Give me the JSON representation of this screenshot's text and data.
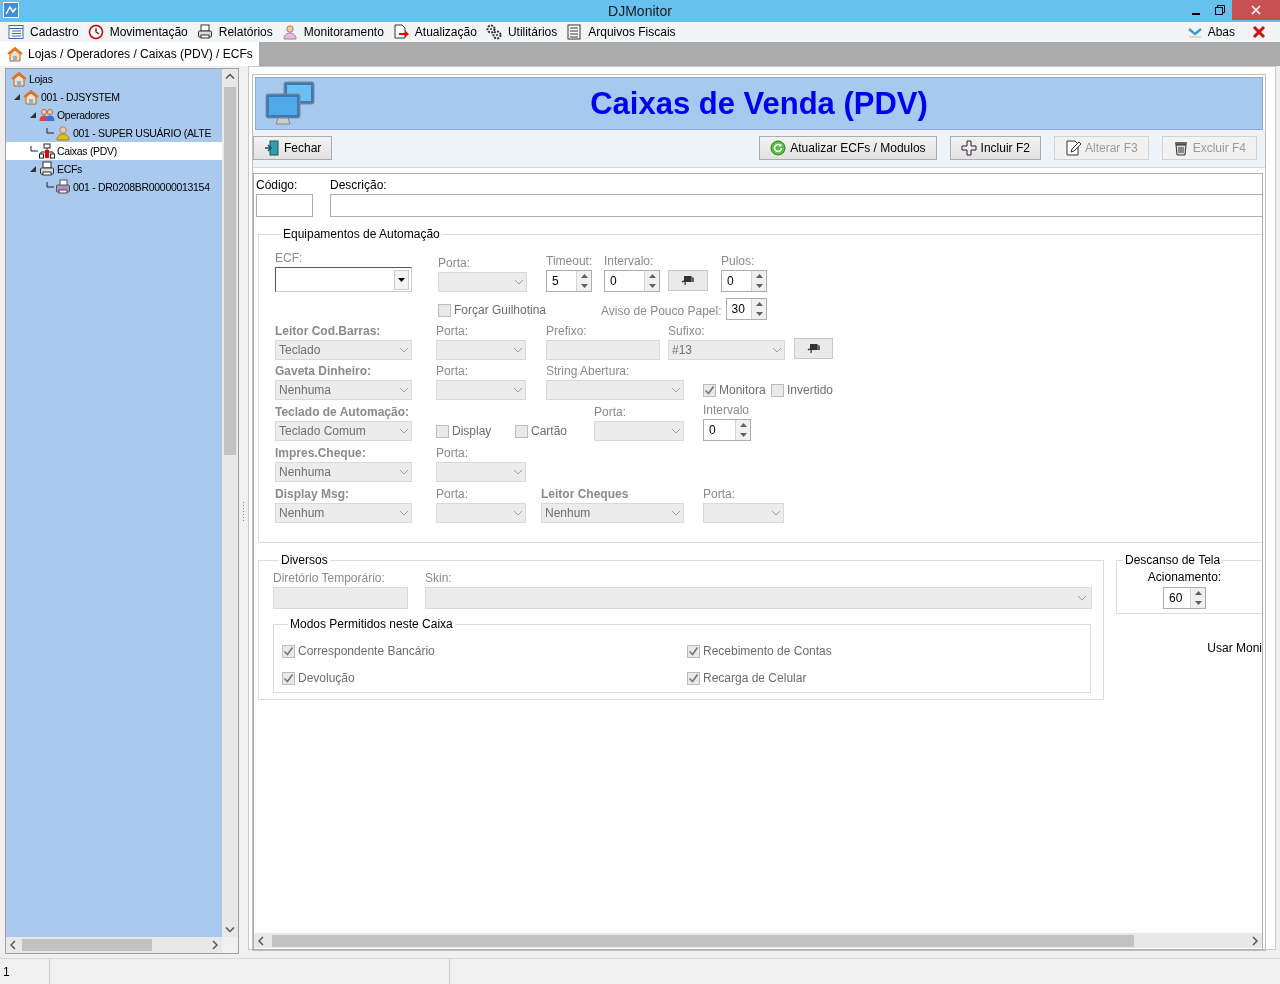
{
  "window": {
    "title": "DJMonitor"
  },
  "menu": [
    "Cadastro",
    "Movimentação",
    "Relatórios",
    "Monitoramento",
    "Atualização",
    "Utilitários",
    "Arquivos Fiscais"
  ],
  "menu_right": {
    "label": "Abas"
  },
  "tab": {
    "label": "Lojas / Operadores / Caixas (PDV) / ECFs"
  },
  "tree": [
    {
      "label": "Lojas",
      "kind": "store",
      "selected": false,
      "children": [
        {
          "label": "001 - DJSYSTEM",
          "kind": "store",
          "selected": false,
          "expanded": true,
          "children": [
            {
              "label": "Operadores",
              "kind": "group",
              "selected": false,
              "expanded": true,
              "children": [
                {
                  "label": "001 - SUPER USUÁRIO (ALTE",
                  "kind": "user",
                  "selected": false
                }
              ]
            },
            {
              "label": "Caixas (PDV)",
              "kind": "register",
              "selected": true
            },
            {
              "label": "ECFs",
              "kind": "printer",
              "selected": false,
              "expanded": true,
              "children": [
                {
                  "label": "001 - DR0208BR00000013154",
                  "kind": "ecf",
                  "selected": false
                }
              ]
            }
          ]
        }
      ]
    }
  ],
  "header": {
    "title": "Caixas de Venda (PDV)"
  },
  "toolbar": {
    "left_buttons": [
      {
        "label": "Fechar",
        "kind": "close",
        "disabled": false
      }
    ],
    "right_buttons": [
      {
        "label": "Atualizar ECFs / Modulos",
        "kind": "refresh",
        "disabled": false
      },
      {
        "label": "Incluir F2",
        "kind": "add",
        "disabled": false
      },
      {
        "label": "Alterar F3",
        "kind": "edit",
        "disabled": true
      },
      {
        "label": "Excluir F4",
        "kind": "delete",
        "disabled": true
      }
    ]
  },
  "record": {
    "code": {
      "label": "Código:"
    },
    "description": {
      "label": "Descrição:"
    }
  },
  "automation": {
    "title": "Equipamentos de Automação",
    "rows": [
      {
        "items": [
          {
            "kind": "combo",
            "label": "ECF:",
            "disabled": false
          },
          {
            "kind": "combo",
            "label": "Porta:",
            "disabled": true
          },
          {
            "kind": "spinner",
            "label": "Timeout:",
            "value": "5",
            "disabled": false
          },
          {
            "kind": "spinner",
            "label": "Intervalo:",
            "value": "0",
            "disabled": false
          },
          {
            "kind": "button",
            "disabled": false
          },
          {
            "kind": "spinner",
            "label": "Pulos:",
            "value": "0",
            "disabled": false
          }
        ]
      },
      {
        "items": [
          {
            "kind": "checkbox",
            "label": "Forçar Guilhotina",
            "checked": false,
            "disabled": true
          },
          {
            "kind": "inline-spinner",
            "label": "Aviso de Pouco Papel:",
            "value": "30",
            "disabled": false
          }
        ]
      },
      {
        "items": [
          {
            "kind": "device",
            "label": "Leitor Cod.Barras:",
            "value": "Teclado",
            "disabled": true
          },
          {
            "kind": "combo",
            "label": "Porta:",
            "disabled": true
          },
          {
            "kind": "text",
            "label": "Prefixo:",
            "disabled": true
          },
          {
            "kind": "combo",
            "label": "Sufixo:",
            "value": "#13",
            "disabled": true
          },
          {
            "kind": "button",
            "disabled": false
          }
        ]
      },
      {
        "items": [
          {
            "kind": "device",
            "label": "Gaveta Dinheiro:",
            "value": "Nenhuma",
            "disabled": true
          },
          {
            "kind": "combo",
            "label": "Porta:",
            "disabled": true
          },
          {
            "kind": "combo",
            "label": "String Abertura:",
            "disabled": true
          },
          {
            "kind": "checkbox",
            "label": "Monitora",
            "checked": true,
            "disabled": true
          },
          {
            "kind": "checkbox",
            "label": "Invertido",
            "checked": false,
            "disabled": true
          }
        ]
      },
      {
        "items": [
          {
            "kind": "device",
            "label": "Teclado de Automação:",
            "value": "Teclado Comum",
            "disabled": true
          },
          {
            "kind": "checkbox",
            "label": "Display",
            "checked": false,
            "disabled": true
          },
          {
            "kind": "checkbox",
            "label": "Cartão",
            "checked": false,
            "disabled": true
          },
          {
            "kind": "combo",
            "label": "Porta:",
            "disabled": true
          },
          {
            "kind": "spinner",
            "label": "Intervalo",
            "value": "0",
            "disabled": false
          }
        ]
      },
      {
        "items": [
          {
            "kind": "device",
            "label": "Impres.Cheque:",
            "value": "Nenhuma",
            "disabled": true
          },
          {
            "kind": "combo",
            "label": "Porta:",
            "disabled": true
          }
        ]
      },
      {
        "items": [
          {
            "kind": "device",
            "label": "Display Msg:",
            "value": "Nenhum",
            "disabled": true
          },
          {
            "kind": "combo",
            "label": "Porta:",
            "disabled": true
          },
          {
            "kind": "device",
            "label": "Leitor Cheques",
            "value": "Nenhum",
            "disabled": true
          },
          {
            "kind": "combo",
            "label": "Porta:",
            "disabled": true
          }
        ]
      }
    ]
  },
  "misc": {
    "title": "Diversos",
    "temp_dir": {
      "label": "Diretório Temporário:",
      "disabled": true
    },
    "skin": {
      "label": "Skin:",
      "disabled": true
    },
    "modes": {
      "title": "Modos Permitidos neste Caixa",
      "options": [
        {
          "label": "Correspondente Bancário",
          "checked": true,
          "disabled": true
        },
        {
          "label": "Recebimento de Contas",
          "checked": true,
          "disabled": true
        },
        {
          "label": "Devolução",
          "checked": true,
          "disabled": true
        },
        {
          "label": "Recarga de Celular",
          "checked": true,
          "disabled": true
        }
      ]
    }
  },
  "screensaver": {
    "title": "Descanso de Tela",
    "label": "Acionamento:",
    "value": "60"
  },
  "monitor_option": {
    "label": "Usar Moni"
  },
  "status_bar": {
    "panels": [
      "1"
    ]
  }
}
